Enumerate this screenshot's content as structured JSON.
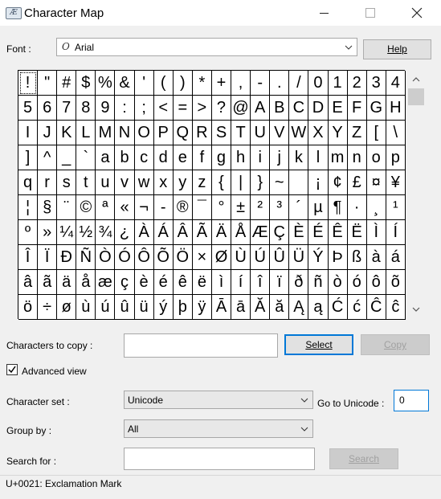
{
  "window": {
    "title": "Character Map"
  },
  "font": {
    "label": "Font :",
    "value": "Arial",
    "icon": "opentype-font-icon"
  },
  "help_button": "Help",
  "grid": {
    "rows": [
      [
        "!",
        "\"",
        "#",
        "$",
        "%",
        "&",
        "'",
        "(",
        ")",
        "*",
        "+",
        ",",
        "-",
        ".",
        "/",
        "0",
        "1",
        "2",
        "3",
        "4"
      ],
      [
        "5",
        "6",
        "7",
        "8",
        "9",
        ":",
        ";",
        "<",
        "=",
        ">",
        "?",
        "@",
        "A",
        "B",
        "C",
        "D",
        "E",
        "F",
        "G",
        "H"
      ],
      [
        "I",
        "J",
        "K",
        "L",
        "M",
        "N",
        "O",
        "P",
        "Q",
        "R",
        "S",
        "T",
        "U",
        "V",
        "W",
        "X",
        "Y",
        "Z",
        "[",
        "\\"
      ],
      [
        "]",
        "^",
        "_",
        "`",
        "a",
        "b",
        "c",
        "d",
        "e",
        "f",
        "g",
        "h",
        "i",
        "j",
        "k",
        "l",
        "m",
        "n",
        "o",
        "p"
      ],
      [
        "q",
        "r",
        "s",
        "t",
        "u",
        "v",
        "w",
        "x",
        "y",
        "z",
        "{",
        "|",
        "}",
        "~",
        "",
        "¡",
        "¢",
        "£",
        "¤",
        "¥"
      ],
      [
        "¦",
        "§",
        "¨",
        "©",
        "ª",
        "«",
        "¬",
        "-",
        "®",
        "¯",
        "°",
        "±",
        "²",
        "³",
        "´",
        "µ",
        "¶",
        "·",
        "¸",
        "¹"
      ],
      [
        "º",
        "»",
        "¼",
        "½",
        "¾",
        "¿",
        "À",
        "Á",
        "Â",
        "Ã",
        "Ä",
        "Å",
        "Æ",
        "Ç",
        "È",
        "É",
        "Ê",
        "Ë",
        "Ì",
        "Í"
      ],
      [
        "Î",
        "Ï",
        "Ð",
        "Ñ",
        "Ò",
        "Ó",
        "Ô",
        "Õ",
        "Ö",
        "×",
        "Ø",
        "Ù",
        "Ú",
        "Û",
        "Ü",
        "Ý",
        "Þ",
        "ß",
        "à",
        "á"
      ],
      [
        "â",
        "ã",
        "ä",
        "å",
        "æ",
        "ç",
        "è",
        "é",
        "ê",
        "ë",
        "ì",
        "í",
        "î",
        "ï",
        "ð",
        "ñ",
        "ò",
        "ó",
        "ô",
        "õ"
      ],
      [
        "ö",
        "÷",
        "ø",
        "ù",
        "ú",
        "û",
        "ü",
        "ý",
        "þ",
        "ÿ",
        "Ā",
        "ā",
        "Ă",
        "ă",
        "Ą",
        "ą",
        "Ć",
        "ć",
        "Ĉ",
        "ĉ"
      ]
    ],
    "selected": "!"
  },
  "copy": {
    "label": "Characters to copy :",
    "value": "",
    "select_button": "Select",
    "copy_button": "Copy"
  },
  "advanced_view": {
    "label": "Advanced view",
    "checked": true
  },
  "character_set": {
    "label": "Character set :",
    "value": "Unicode"
  },
  "goto_unicode": {
    "label": "Go to Unicode :",
    "value": "0"
  },
  "group_by": {
    "label": "Group by :",
    "value": "All"
  },
  "search": {
    "label": "Search for :",
    "value": "",
    "button": "Search"
  },
  "status": {
    "text": "U+0021: Exclamation Mark"
  }
}
